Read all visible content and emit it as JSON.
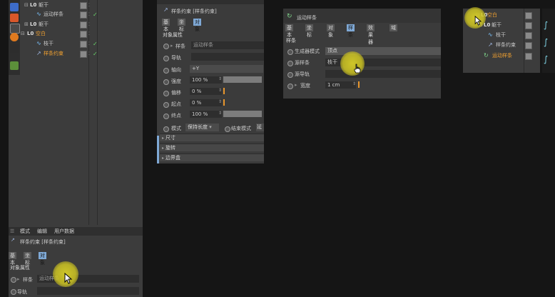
{
  "left_panel": {
    "tree": [
      {
        "name": "躯干",
        "type": "null",
        "indent": 1
      },
      {
        "name": "运动样条",
        "type": "spline",
        "indent": 2
      },
      {
        "name": "躯干",
        "type": "null",
        "indent": 1
      },
      {
        "name": "空白",
        "type": "null",
        "indent": 0,
        "highlight": "orange"
      },
      {
        "name": "枝干",
        "type": "spline",
        "indent": 2
      },
      {
        "name": "样条约束",
        "type": "constraint",
        "indent": 2,
        "highlight": "orange"
      }
    ],
    "menu": [
      "模式",
      "编辑",
      "用户数据"
    ],
    "object_title": "样条约束 [样条约束]",
    "tabs": [
      "基本",
      "坐标",
      "对象"
    ],
    "active_tab": "对象",
    "section": "对象属性",
    "spline_label": "样条",
    "spline_value": "运动样条",
    "rail_label": "导轨"
  },
  "middle_panel": {
    "object_title": "样条约束 [样条约束]",
    "tabs": [
      "基本",
      "坐标",
      "对象"
    ],
    "active_tab": "对象",
    "section": "对象属性",
    "spline_label": "样条",
    "spline_value": "运动样条",
    "rail_label": "导轨",
    "axis_label": "轴向",
    "axis_value": "+Y",
    "strength_label": "强度",
    "strength_value": "100 %",
    "strength_level": 1.0,
    "offset_label": "偏移",
    "offset_value": "0 %",
    "start_label": "起点",
    "start_value": "0 %",
    "end_label": "终点",
    "end_value": "100 %",
    "end_level": 1.0,
    "mode_label": "模式",
    "mode_value": "保持长度",
    "end_mode_label": "结束模式",
    "end_mode_value": "延",
    "groups": [
      "尺寸",
      "旋转",
      "边界盒"
    ]
  },
  "right_panel": {
    "object_title": "运动样条",
    "tabs": [
      "基本",
      "坐标",
      "对象",
      "样条",
      "效果器",
      "域"
    ],
    "active_tab": "样条",
    "section": "样条",
    "generator_mode_label": "生成器模式",
    "generator_mode_value": "顶点",
    "source_spline_label": "源样条",
    "source_spline_value": "枝干",
    "source_rail_label": "源导轨",
    "width_label": "宽度",
    "width_value": "1 cm"
  },
  "far_panel": {
    "tree": [
      {
        "name": "空白",
        "highlight": "orange"
      },
      {
        "name": "躯干"
      },
      {
        "name": "枝干"
      },
      {
        "name": "样条约束"
      },
      {
        "name": "运动样条",
        "highlight": "orange"
      }
    ]
  },
  "colors": {
    "panel_bg": "#3b3b3b",
    "active_tab": "#7fa9d6",
    "highlight_orange": "#f0a030",
    "check_green": "#69d269",
    "cursor_highlight": "#d8ce28"
  }
}
